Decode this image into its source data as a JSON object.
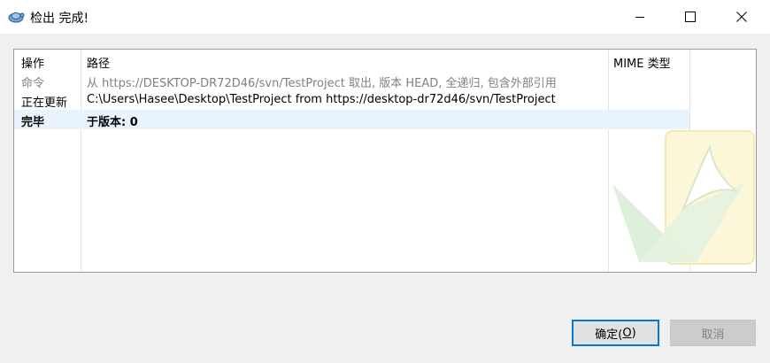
{
  "window": {
    "title": "检出 完成!"
  },
  "table": {
    "columns": [
      "操作",
      "路径",
      "MIME 类型"
    ],
    "rows": [
      {
        "action": "命令",
        "path": "从 https://DESKTOP-DR72D46/svn/TestProject 取出, 版本 HEAD, 全递归, 包含外部引用",
        "mime": "",
        "style": "gray"
      },
      {
        "action": "正在更新",
        "path": "C:\\Users\\Hasee\\Desktop\\TestProject from https://desktop-dr72d46/svn/TestProject",
        "mime": "",
        "style": "normal"
      },
      {
        "action": "完毕",
        "path": "于版本: 0",
        "mime": "",
        "style": "bold"
      }
    ]
  },
  "buttons": {
    "ok_prefix": "确定(",
    "ok_mnemonic": "O",
    "ok_suffix": ")",
    "cancel": "取消"
  },
  "colors": {
    "selection": "#e8f3fd",
    "focus_border": "#0078d7",
    "disabled_text": "#838383"
  }
}
